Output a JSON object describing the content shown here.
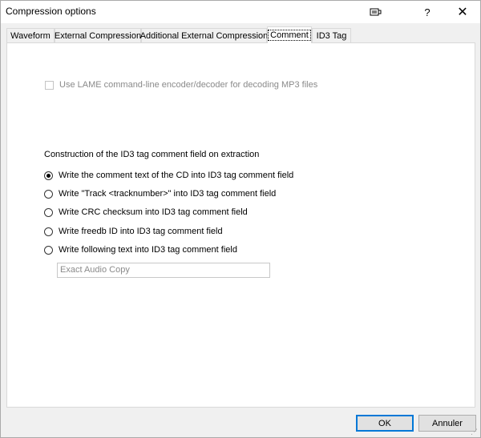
{
  "window": {
    "title": "Compression options",
    "help_label": "?",
    "close_label": "✕"
  },
  "tabs": [
    {
      "label": "Waveform"
    },
    {
      "label": "External Compression"
    },
    {
      "label": "Additional External Compression"
    },
    {
      "label": "Comment"
    },
    {
      "label": "ID3 Tag"
    }
  ],
  "active_tab": "Comment",
  "comment": {
    "lame_checkbox_label": "Use LAME command-line encoder/decoder for decoding MP3 files",
    "lame_checked": false,
    "lame_enabled": false,
    "group_label": "Construction of the ID3 tag comment field on extraction",
    "options": [
      {
        "label": "Write the comment text of the CD into ID3 tag comment field",
        "checked": true
      },
      {
        "label": "Write \"Track <tracknumber>\" into ID3 tag comment field",
        "checked": false
      },
      {
        "label": "Write CRC checksum into ID3 tag comment field",
        "checked": false
      },
      {
        "label": "Write freedb ID into ID3 tag comment field",
        "checked": false
      },
      {
        "label": "Write following text into ID3 tag comment field",
        "checked": false
      }
    ],
    "custom_text_value": "Exact Audio Copy"
  },
  "buttons": {
    "ok": "OK",
    "cancel": "Annuler"
  }
}
